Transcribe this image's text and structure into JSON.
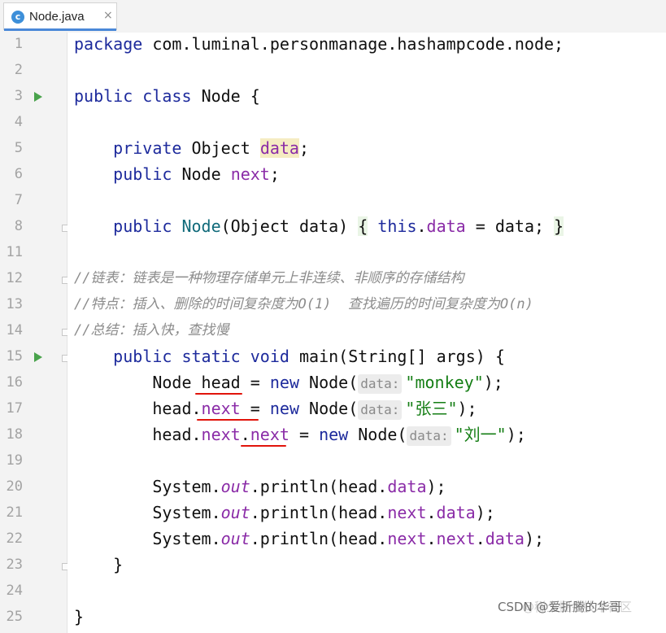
{
  "tab": {
    "filename": "Node.java",
    "icon_letter": "c",
    "close_glyph": "×"
  },
  "watermark": {
    "csdn": "CSDN @爱折腾的华哥",
    "juejin": "@稀土掘金技术社区"
  },
  "hints": {
    "data": "data:"
  },
  "lines": [
    {
      "n": "1",
      "parts": [
        "package",
        "com.luminal.personmanage.hashampcode.node;"
      ]
    },
    {
      "n": "2"
    },
    {
      "n": "3",
      "parts": [
        "public",
        "class",
        "Node",
        "{"
      ]
    },
    {
      "n": "4"
    },
    {
      "n": "5",
      "parts": [
        "private",
        "Object",
        "data",
        ";"
      ]
    },
    {
      "n": "6",
      "parts": [
        "public",
        "Node",
        "next",
        ";"
      ]
    },
    {
      "n": "7"
    },
    {
      "n": "8",
      "parts": [
        "public",
        "Node",
        "(Object data)",
        "{",
        "this",
        ".",
        "data",
        "= data;",
        "}"
      ]
    },
    {
      "n": "11"
    },
    {
      "n": "12",
      "comment": "//链表：链表是一种物理存储单元上非连续、非顺序的存储结构"
    },
    {
      "n": "13",
      "comment": "//特点：插入、删除的时间复杂度为O(1)  查找遍历的时间复杂度为O(n)"
    },
    {
      "n": "14",
      "comment": "//总结：插入快，查找慢"
    },
    {
      "n": "15",
      "parts": [
        "public",
        "static",
        "void",
        "main",
        "(String[] args) {"
      ]
    },
    {
      "n": "16",
      "parts": [
        "Node",
        "head",
        "=",
        "new",
        "Node(",
        "\"monkey\"",
        ");"
      ]
    },
    {
      "n": "17",
      "parts": [
        "head.",
        "next",
        "=",
        "new",
        "Node(",
        "\"张三\"",
        ");"
      ]
    },
    {
      "n": "18",
      "parts": [
        "head.",
        "next",
        ".",
        "next",
        "=",
        "new",
        "Node(",
        "\"刘一\"",
        ");"
      ]
    },
    {
      "n": "19"
    },
    {
      "n": "20",
      "parts": [
        "System.",
        "out",
        ".println(head.",
        "data",
        ");"
      ]
    },
    {
      "n": "21",
      "parts": [
        "System.",
        "out",
        ".println(head.",
        "next",
        ".",
        "data",
        ");"
      ]
    },
    {
      "n": "22",
      "parts": [
        "System.",
        "out",
        ".println(head.",
        "next",
        ".",
        "next",
        ".",
        "data",
        ");"
      ]
    },
    {
      "n": "23",
      "parts": [
        "}"
      ]
    },
    {
      "n": "24"
    },
    {
      "n": "25",
      "parts": [
        "}"
      ]
    }
  ]
}
